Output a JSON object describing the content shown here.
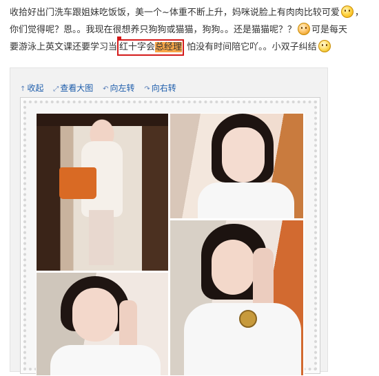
{
  "post": {
    "line1": "收拾好出门洗车跟姐妹吃饭饭，美一个~体重不断上升，妈咪说脸上有肉肉比较可爱",
    "line1_end": "，",
    "line2_start": "你们觉得呢？恩。。我现在很想养只狗狗或猫猫，狗狗。。还是猫猫呢？？",
    "line2_end": "可是每天",
    "line3_start": "要游泳上英文课还要学习当",
    "line3_boxed_plain": "红十字会",
    "line3_boxed_highlight": "总经理",
    "line3_end": "  怕没有时间陪它吖。。小双子纠结",
    "emojis": [
      "smile-emoji",
      "sad-emoji",
      "puzzled-emoji"
    ]
  },
  "toolbar": {
    "collapse": "收起",
    "view_large": "查看大图",
    "rotate_left": "向左转",
    "rotate_right": "向右转"
  },
  "colors": {
    "link": "#1c5cab",
    "highlight_box": "#d41a1a",
    "highlight_fill": "#f7a648"
  }
}
